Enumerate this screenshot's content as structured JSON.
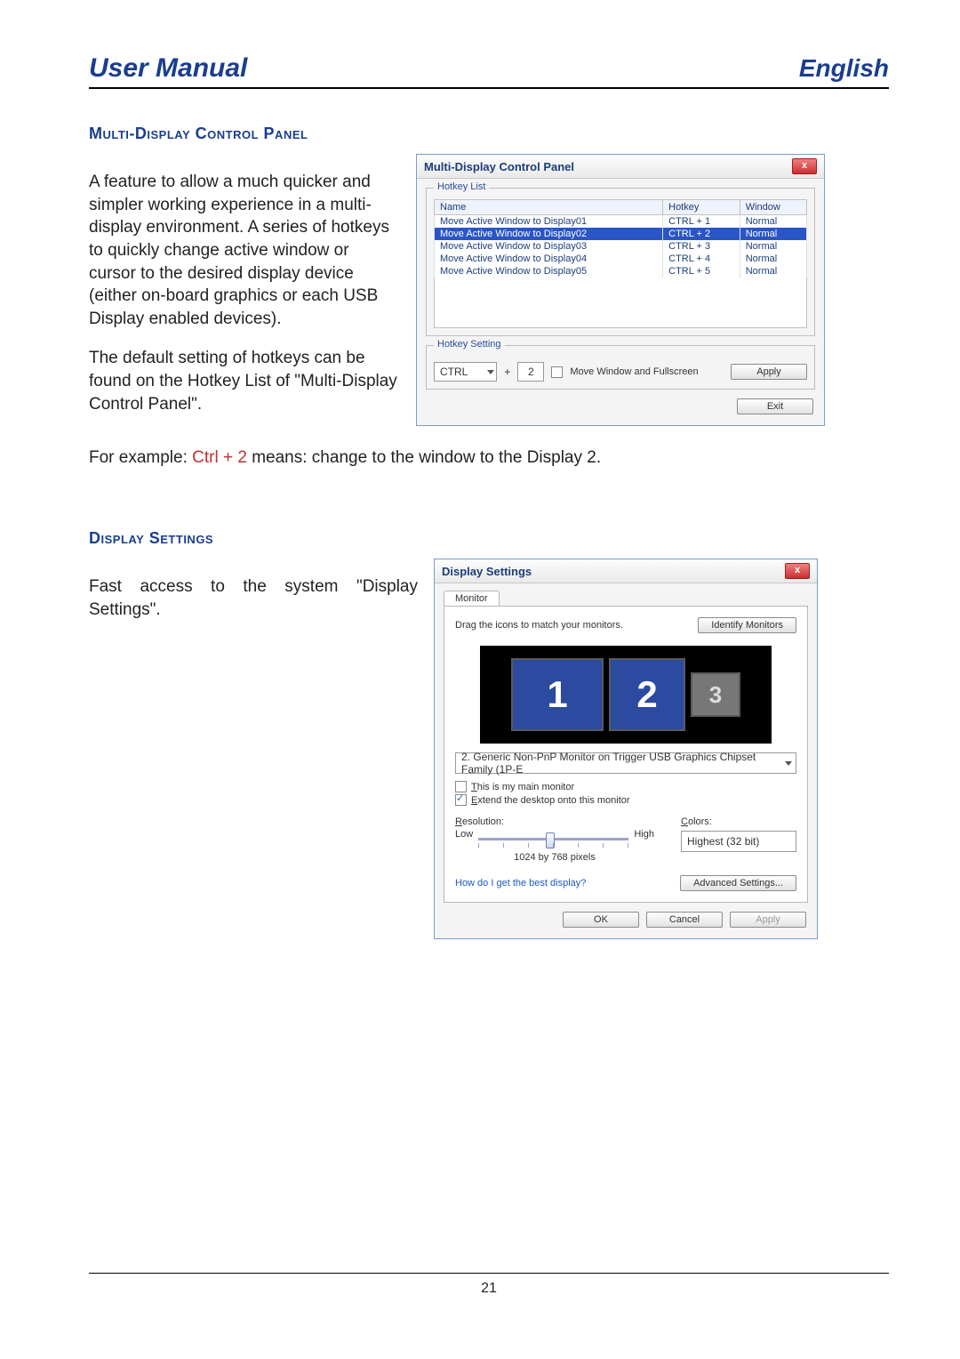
{
  "page": {
    "header_title": "User Manual",
    "header_lang": "English",
    "page_number": "21"
  },
  "section1": {
    "heading": "Multi-Display Control Panel",
    "para1": "A feature to allow a much quicker and simpler working experience in a multi-display environment.  A series of hotkeys  to quickly change active window or cursor to the desired display device (either on-board graphics or each USB Display enabled devices).",
    "para2": "The default setting of hotkeys can be found on the Hotkey List of \"Multi-Display Control Panel\".",
    "example_label": "For example: ",
    "example_hotkey": "Ctrl + 2",
    "example_rest": " means: change to the window to the Display 2."
  },
  "dialog1": {
    "title": "Multi-Display Control Panel",
    "close": "x",
    "group_list": "Hotkey List",
    "cols": {
      "c1": "Name",
      "c2": "Hotkey",
      "c3": "Window"
    },
    "rows": [
      {
        "name": "Move Active Window to Display01",
        "hotkey": "CTRL + 1",
        "win": "Normal",
        "selected": false
      },
      {
        "name": "Move Active Window to Display02",
        "hotkey": "CTRL + 2",
        "win": "Normal",
        "selected": true
      },
      {
        "name": "Move Active Window to Display03",
        "hotkey": "CTRL + 3",
        "win": "Normal",
        "selected": false
      },
      {
        "name": "Move Active Window to Display04",
        "hotkey": "CTRL + 4",
        "win": "Normal",
        "selected": false
      },
      {
        "name": "Move Active Window to Display05",
        "hotkey": "CTRL + 5",
        "win": "Normal",
        "selected": false
      }
    ],
    "group_setting": "Hotkey Setting",
    "modifier": "CTRL",
    "plus": "+",
    "digit": "2",
    "chk_label": "Move Window and Fullscreen",
    "apply": "Apply",
    "exit": "Exit"
  },
  "section2": {
    "heading": "Display Settings",
    "para": "Fast  access  to  the  system  \"Display Settings\"."
  },
  "dialog2": {
    "title": "Display Settings",
    "close": "x",
    "tab": "Monitor",
    "drag_text": "Drag the icons to match your monitors.",
    "identify": "Identify Monitors",
    "monitors": {
      "m1": "1",
      "m2": "2",
      "m3": "3"
    },
    "selected_monitor": "2. Generic Non-PnP Monitor on Trigger USB Graphics Chipset Family (1P-E",
    "chk_main_prefix": "T",
    "chk_main_rest": "his is my main monitor",
    "chk_ext_prefix": "E",
    "chk_ext_rest": "xtend the desktop onto this monitor",
    "res_label_prefix": "R",
    "res_label_rest": "esolution:",
    "colors_label_prefix": "C",
    "colors_label_rest": "olors:",
    "low": "Low",
    "high": "High",
    "res_value": "1024 by 768 pixels",
    "colors_value": "Highest (32 bit)",
    "help_link": "How do I get the best display?",
    "adv": "Advanced Settings...",
    "ok": "OK",
    "cancel": "Cancel",
    "apply": "Apply"
  }
}
